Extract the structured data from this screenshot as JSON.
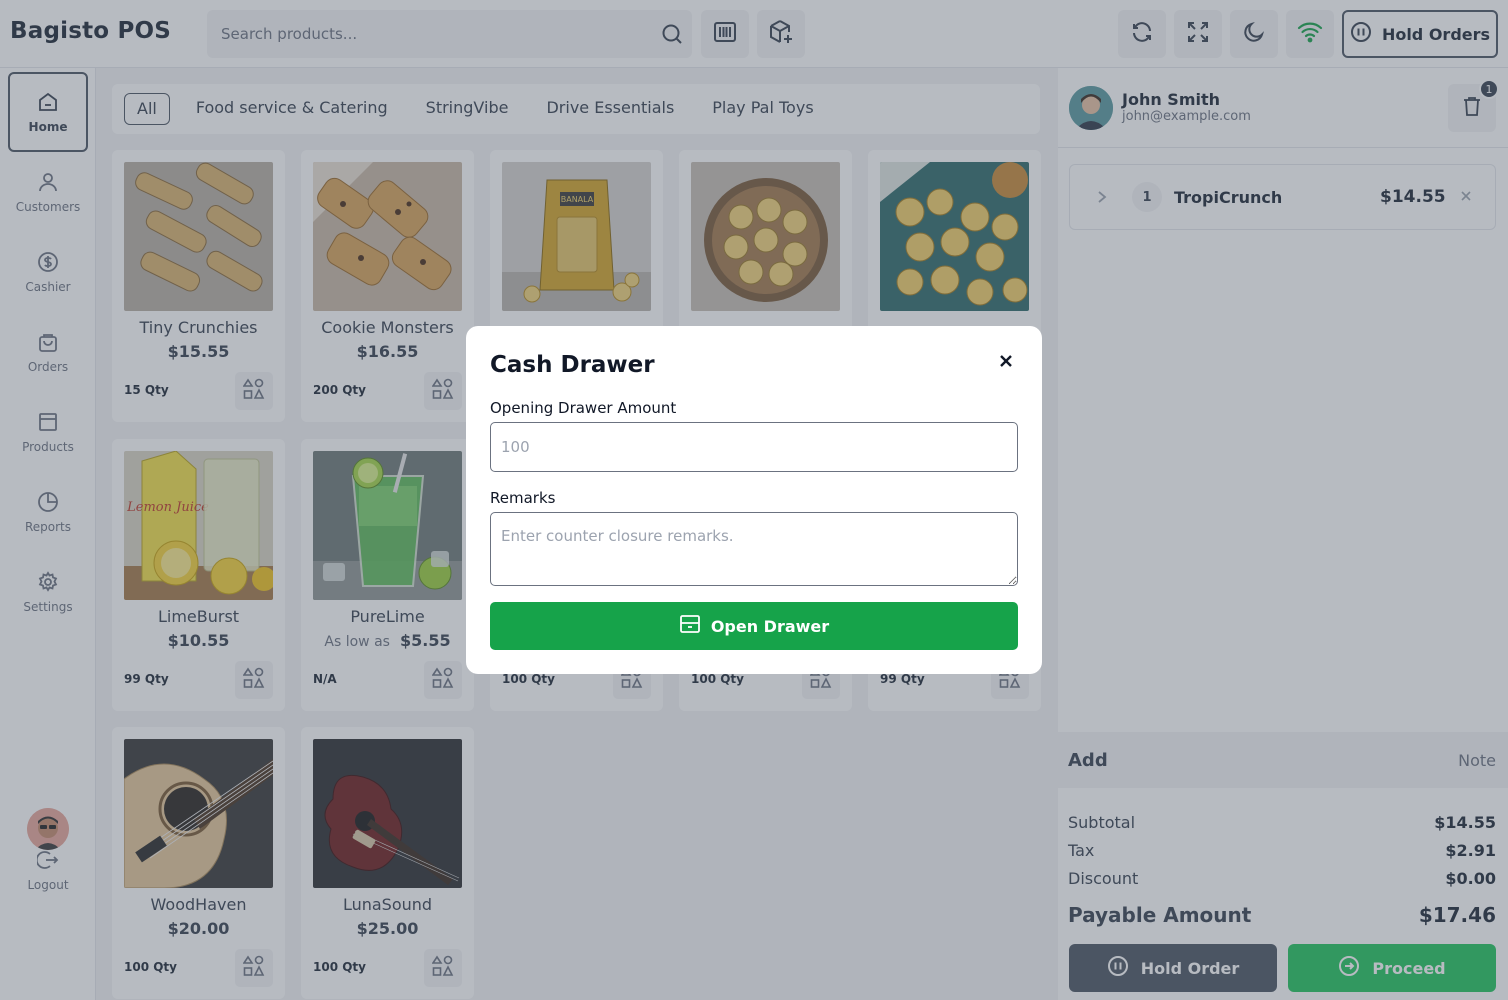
{
  "app": {
    "brand": "Bagisto POS"
  },
  "colors": {
    "accent_green": "#16a34a",
    "hold_gray": "#4b5563",
    "proceed_green": "#22c55e"
  },
  "header": {
    "search_placeholder": "Search products...",
    "icons": [
      "search-icon",
      "barcode-icon",
      "add-product-icon",
      "refresh-icon",
      "fullscreen-icon",
      "dark-mode-icon",
      "wifi-icon"
    ],
    "hold_orders_label": "Hold Orders"
  },
  "sidebar": {
    "items": [
      {
        "label": "Home",
        "icon": "home-icon",
        "active": true
      },
      {
        "label": "Customers",
        "icon": "user-icon"
      },
      {
        "label": "Cashier",
        "icon": "dollar-icon"
      },
      {
        "label": "Orders",
        "icon": "bag-icon"
      },
      {
        "label": "Products",
        "icon": "box-icon"
      },
      {
        "label": "Reports",
        "icon": "pie-chart-icon"
      },
      {
        "label": "Settings",
        "icon": "gear-icon"
      }
    ],
    "logout_label": "Logout"
  },
  "categories": [
    {
      "label": "All",
      "active": true
    },
    {
      "label": "Food service & Catering"
    },
    {
      "label": "StringVibe"
    },
    {
      "label": "Drive Essentials"
    },
    {
      "label": "Play Pal Toys"
    }
  ],
  "products": [
    {
      "name": "Tiny Crunchies",
      "price": "$15.55",
      "qty": "15 Qty"
    },
    {
      "name": "Cookie Monsters",
      "price": "$16.55",
      "qty": "200 Qty"
    },
    {
      "name": "",
      "price": "",
      "qty": "",
      "image_text": "BANALA"
    },
    {
      "name": "",
      "price": "",
      "qty": ""
    },
    {
      "name": "",
      "price": "",
      "qty": ""
    },
    {
      "name": "LimeBurst",
      "price": "$10.55",
      "qty": "99 Qty",
      "image_text": "Lemon Juice"
    },
    {
      "name": "PureLime",
      "as_low_as_label": "As low as",
      "price": "$5.55",
      "qty": "N/A"
    },
    {
      "name": "",
      "price": "",
      "qty": "100 Qty"
    },
    {
      "name": "",
      "price": "",
      "qty": "100 Qty"
    },
    {
      "name": "",
      "price": "",
      "qty": "99 Qty"
    },
    {
      "name": "WoodHaven",
      "price": "$20.00",
      "qty": "100 Qty"
    },
    {
      "name": "LunaSound",
      "price": "$25.00",
      "qty": "100 Qty"
    }
  ],
  "cart": {
    "customer_name": "John Smith",
    "customer_email": "john@example.com",
    "badge_count": "1",
    "items": [
      {
        "qty": "1",
        "name": "TropiCrunch",
        "price": "$14.55"
      }
    ],
    "add_label": "Add",
    "note_label": "Note",
    "summary": {
      "subtotal_label": "Subtotal",
      "subtotal": "$14.55",
      "tax_label": "Tax",
      "tax": "$2.91",
      "discount_label": "Discount",
      "discount": "$0.00",
      "payable_label": "Payable Amount",
      "payable": "$17.46"
    },
    "hold_order_label": "Hold Order",
    "proceed_label": "Proceed"
  },
  "modal": {
    "title": "Cash Drawer",
    "opening_label": "Opening Drawer Amount",
    "opening_placeholder": "100",
    "remarks_label": "Remarks",
    "remarks_placeholder": "Enter counter closure remarks.",
    "submit_label": "Open Drawer"
  }
}
